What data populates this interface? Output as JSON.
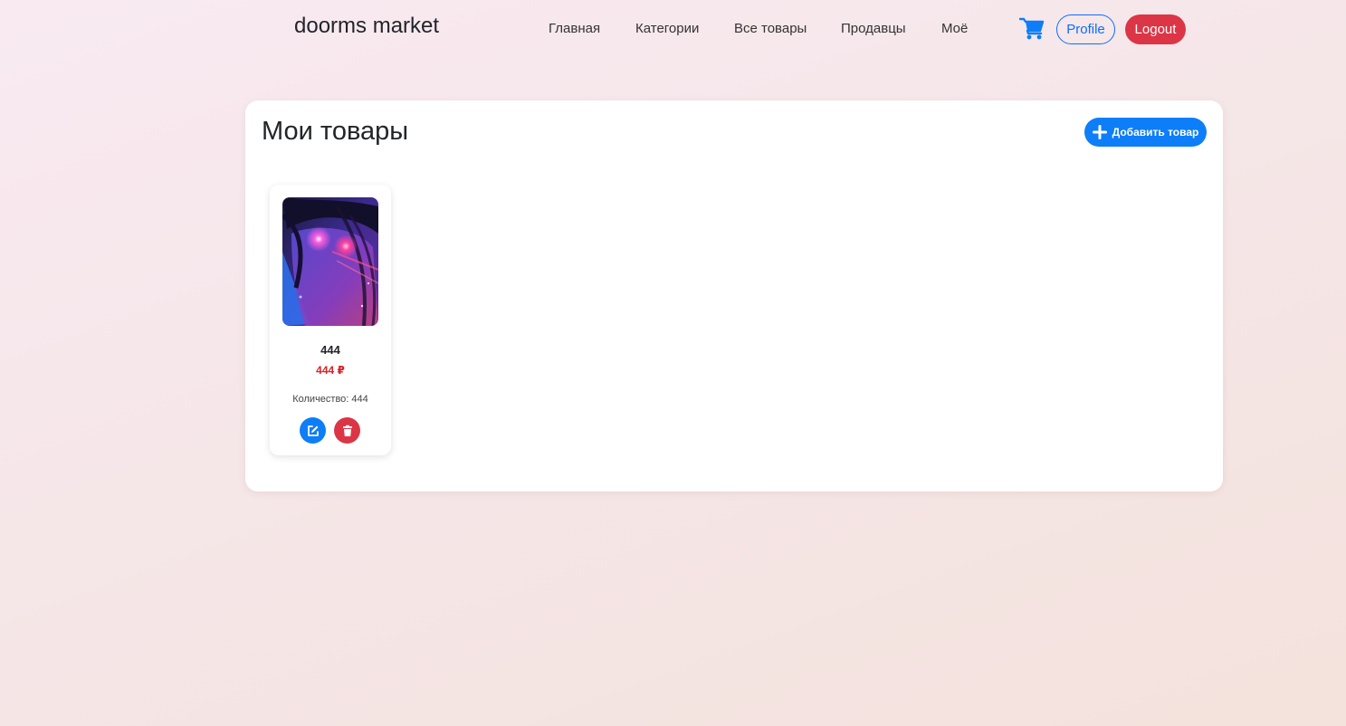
{
  "navbar": {
    "brand": "doorms market",
    "links": [
      "Главная",
      "Категории",
      "Все товары",
      "Продавцы",
      "Моё"
    ],
    "profile_label": "Profile",
    "logout_label": "Logout",
    "cart_icon": "shopping-cart-icon",
    "accent_color": "#0d6efd",
    "danger_color": "#dc3545"
  },
  "main": {
    "title": "Мои товары",
    "add_button_label": "Добавить товар",
    "add_icon": "plus-icon"
  },
  "products": [
    {
      "name": "444",
      "price": "444 ₽",
      "quantity_label": "Количество:",
      "quantity": "444",
      "image": "anime-portrait-image",
      "edit_icon": "edit-icon",
      "delete_icon": "trash-icon"
    }
  ]
}
